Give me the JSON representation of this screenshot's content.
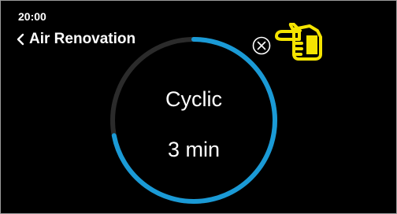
{
  "status_bar": {
    "time": "20:00"
  },
  "header": {
    "back_icon": "chevron-left-icon",
    "title": "Air Renovation"
  },
  "dial": {
    "mode": "Cyclic",
    "duration": "3 min",
    "progress_fraction": 0.72,
    "track_color": "#2b2b2b",
    "fill_color": "#1a9ad6"
  },
  "close": {
    "icon": "close-circle-icon"
  },
  "hint": {
    "icon": "pointing-hand-icon",
    "color": "#f5e400"
  }
}
